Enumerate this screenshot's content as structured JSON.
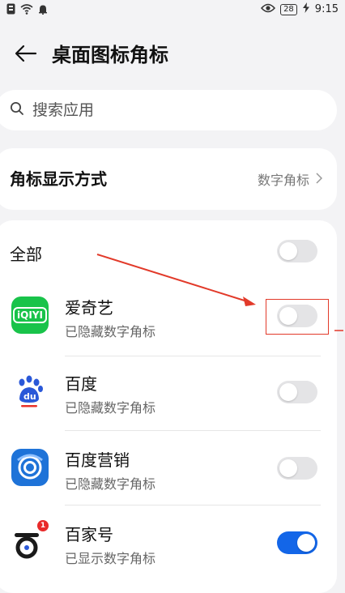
{
  "status_bar": {
    "battery": "28",
    "time": "9:15"
  },
  "header": {
    "title": "桌面图标角标"
  },
  "search": {
    "placeholder": "搜索应用"
  },
  "badge_mode": {
    "label": "角标显示方式",
    "value": "数字角标"
  },
  "all_toggle": {
    "label": "全部",
    "on": false
  },
  "apps": [
    {
      "name": "爱奇艺",
      "status": "已隐藏数字角标",
      "on": false,
      "icon": "iqiyi-icon",
      "icon_text": "iQIYI"
    },
    {
      "name": "百度",
      "status": "已隐藏数字角标",
      "on": false,
      "icon": "baidu-icon",
      "icon_text": "du"
    },
    {
      "name": "百度营销",
      "status": "已隐藏数字角标",
      "on": false,
      "icon": "baidu-marketing-icon"
    },
    {
      "name": "百家号",
      "status": "已显示数字角标",
      "on": true,
      "icon": "baijiahao-icon",
      "badge_count": "1"
    }
  ],
  "colors": {
    "accent": "#1366e8",
    "annotation": "#e23a2a",
    "iqiyi": "#19c34a",
    "baidu_marketing": "#1e73d8"
  }
}
